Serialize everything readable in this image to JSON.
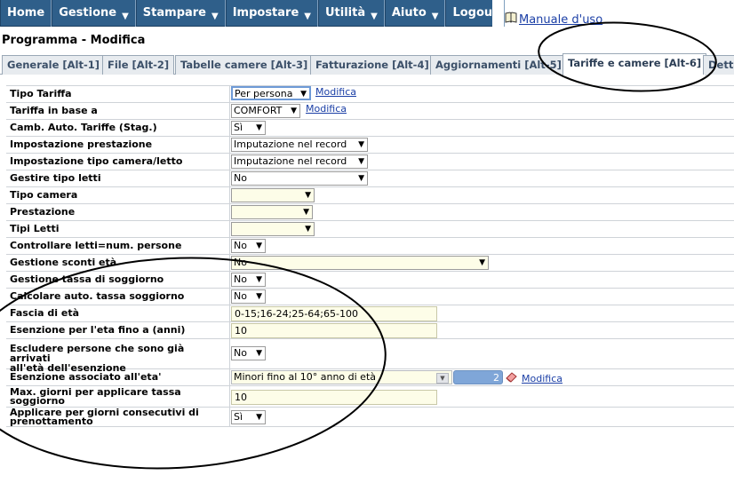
{
  "menu": {
    "items": [
      {
        "label": "Home",
        "caret": false
      },
      {
        "label": "Gestione",
        "caret": true
      },
      {
        "label": "Stampare",
        "caret": true
      },
      {
        "label": "Impostare",
        "caret": true
      },
      {
        "label": "Utilità",
        "caret": true
      },
      {
        "label": "Aiuto",
        "caret": true
      },
      {
        "label": "Logout",
        "caret": false
      }
    ],
    "help_link": "Manuale d'uso"
  },
  "page_title": "Programma - Modifica",
  "tabs": [
    {
      "label": "Generale [Alt-1]"
    },
    {
      "label": "File [Alt-2]"
    },
    {
      "label": "Tabelle camere [Alt-3]"
    },
    {
      "label": "Fatturazione [Alt-4]"
    },
    {
      "label": "Aggiornamenti [Alt-5]"
    },
    {
      "label": "Tariffe e camere [Alt-6]",
      "active": true
    },
    {
      "label": "Dettagli"
    }
  ],
  "form": {
    "tipo_tariffa": {
      "label": "Tipo Tariffa",
      "value": "Per persona",
      "link": "Modifica"
    },
    "tariffa_in_base_a": {
      "label": "Tariffa in base a",
      "value": "COMFORT",
      "link": "Modifica"
    },
    "camb_auto_tariffe": {
      "label": "Camb. Auto. Tariffe (Stag.)",
      "value": "Sì"
    },
    "impostazione_prestazione": {
      "label": "Impostazione prestazione",
      "value": "Imputazione nel record"
    },
    "impostazione_tipo_camera": {
      "label": "Impostazione tipo camera/letto",
      "value": "Imputazione nel record"
    },
    "gestire_tipo_letti": {
      "label": "Gestire tipo letti",
      "value": "No"
    },
    "tipo_camera": {
      "label": "Tipo camera",
      "value": ""
    },
    "prestazione": {
      "label": "Prestazione",
      "value": ""
    },
    "tipi_letti": {
      "label": "Tipi Letti",
      "value": ""
    },
    "controllare_letti": {
      "label": "Controllare letti=num. persone",
      "value": "No"
    },
    "gestione_sconti": {
      "label": "Gestione sconti età",
      "value": "No"
    },
    "gestione_tassa": {
      "label": "Gestione tassa di soggiorno",
      "value": "No"
    },
    "calcolare_tassa": {
      "label": "Calcolare auto. tassa soggiorno",
      "value": "No"
    },
    "fascia_eta": {
      "label": "Fascia di età",
      "value": "0-15;16-24;25-64;65-100"
    },
    "esenzione_eta": {
      "label": "Esenzione per l'eta fino a (anni)",
      "value": "10"
    },
    "escludere": {
      "label_line1": "Escludere persone che sono già arrivati",
      "label_line2": "all'età dell'esenzione",
      "value": "No"
    },
    "esenzione_associato": {
      "label": "Esenzione associato all'eta'",
      "value": "Minori fino al 10° anno di età",
      "counter": "2",
      "link": "Modifica"
    },
    "max_giorni": {
      "label_line1": "Max. giorni per applicare tassa",
      "label_line2": "soggiorno",
      "value": "10"
    },
    "applicare": {
      "label_line1": "Applicare per giorni consecutivi di",
      "label_line2": "prenottamento",
      "value": "Sì"
    }
  },
  "colors": {
    "menu_bg": "#2f5f8a",
    "tab_bg": "#e7ebef",
    "input_bg": "#fdfde8",
    "link": "#1b3fa6"
  }
}
